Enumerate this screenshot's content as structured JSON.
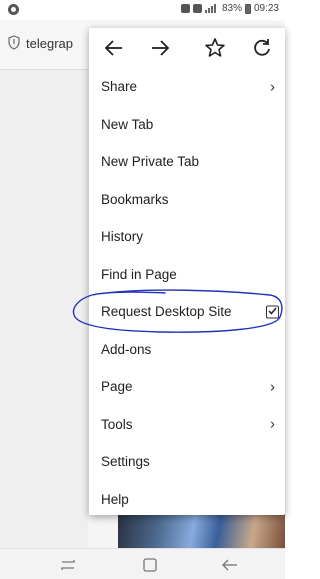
{
  "status_bar": {
    "battery_text": "83%",
    "time": "09:23"
  },
  "url_bar": {
    "url_text": "telegrap"
  },
  "menu": {
    "nav_icons": [
      "back-arrow-icon",
      "forward-arrow-icon",
      "star-icon",
      "reload-icon"
    ],
    "items": [
      {
        "label": "Share",
        "chevron": true
      },
      {
        "label": "New Tab"
      },
      {
        "label": "New Private Tab"
      },
      {
        "label": "Bookmarks"
      },
      {
        "label": "History"
      },
      {
        "label": "Find in Page"
      },
      {
        "label": "Request Desktop Site",
        "checkbox": true,
        "checked": true
      },
      {
        "label": "Add-ons"
      },
      {
        "label": "Page",
        "chevron": true
      },
      {
        "label": "Tools",
        "chevron": true
      },
      {
        "label": "Settings"
      },
      {
        "label": "Help"
      }
    ]
  },
  "chevron_glyph": "›",
  "annotation_color": "#2233bb"
}
